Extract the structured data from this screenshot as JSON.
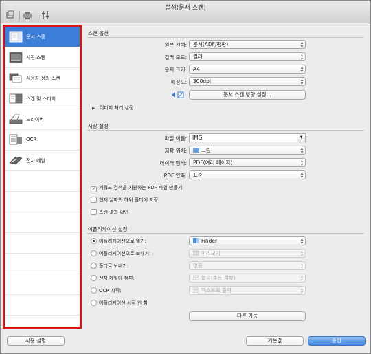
{
  "window": {
    "title": "설정(문서 스캔)"
  },
  "toolbar": {
    "icons": [
      "scan-from-computer-icon",
      "scan-from-operation-panel-icon",
      "general-settings-icon"
    ]
  },
  "sidebar": {
    "items": [
      {
        "label": "문서 스캔",
        "icon": "document-scan-icon",
        "active": true
      },
      {
        "label": "사진 스캔",
        "icon": "photo-scan-icon",
        "active": false
      },
      {
        "label": "사용자 정의 스캔",
        "icon": "custom-scan-icon",
        "active": false
      },
      {
        "label": "스캔 및 스티치",
        "icon": "scan-and-stitch-icon",
        "active": false
      },
      {
        "label": "드라이버",
        "icon": "driver-icon",
        "active": false
      },
      {
        "label": "OCR",
        "icon": "ocr-icon",
        "active": false
      },
      {
        "label": "전자 메일",
        "icon": "email-icon",
        "active": false
      }
    ]
  },
  "scan_options": {
    "header": "스캔 옵션",
    "source_label": "원본 선택:",
    "source_value": "문서(ADF/평판)",
    "color_mode_label": "컬러 모드:",
    "color_mode_value": "컬러",
    "paper_size_label": "용지 크기:",
    "paper_size_value": "A4",
    "resolution_label": "해상도:",
    "resolution_value": "300dpi",
    "orientation_button": "문서 스캔 방향 설정...",
    "image_processing": "이미지 처리 설정"
  },
  "save_settings": {
    "header": "저장 설정",
    "file_name_label": "파일 이름:",
    "file_name_value": "IMG",
    "save_in_label": "저장 위치:",
    "save_in_value": "그림",
    "data_format_label": "데이터 형식:",
    "data_format_value": "PDF(여러 페이지)",
    "pdf_compression_label": "PDF 압축:",
    "pdf_compression_value": "표준",
    "keyword_pdf": {
      "label": "키워드 검색을 지원하는 PDF 파일 만들기",
      "checked": true
    },
    "date_subfolder": {
      "label": "현재 날짜의 하위 폴더에 저장",
      "checked": false
    },
    "check_results": {
      "label": "스캔 결과 확인",
      "checked": false
    }
  },
  "app_settings": {
    "header": "어플리케이션 설정",
    "open_with": {
      "label": "어플리케이션으로 열기:",
      "value": "Finder",
      "selected": true
    },
    "send_to_app": {
      "label": "어플리케이션으로 보내기:",
      "value": "미리보기",
      "selected": false
    },
    "send_to_folder": {
      "label": "폴더로 보내기:",
      "value": "없음",
      "selected": false
    },
    "attach_email": {
      "label": "전자 메일에 첨부:",
      "value": "없음(수동 첨부)",
      "selected": false
    },
    "start_ocr": {
      "label": "OCR 시작:",
      "value": "텍스트로 출력",
      "selected": false
    },
    "do_not_start": {
      "label": "어플리케이션 시작 안 함",
      "selected": false
    },
    "more_functions_button": "다른 기능"
  },
  "footer": {
    "instructions_button": "사용 설명",
    "defaults_button": "기본값",
    "ok_button": "승인"
  },
  "colors": {
    "accent": "#3c7fd9",
    "highlight_border": "#e01010"
  }
}
